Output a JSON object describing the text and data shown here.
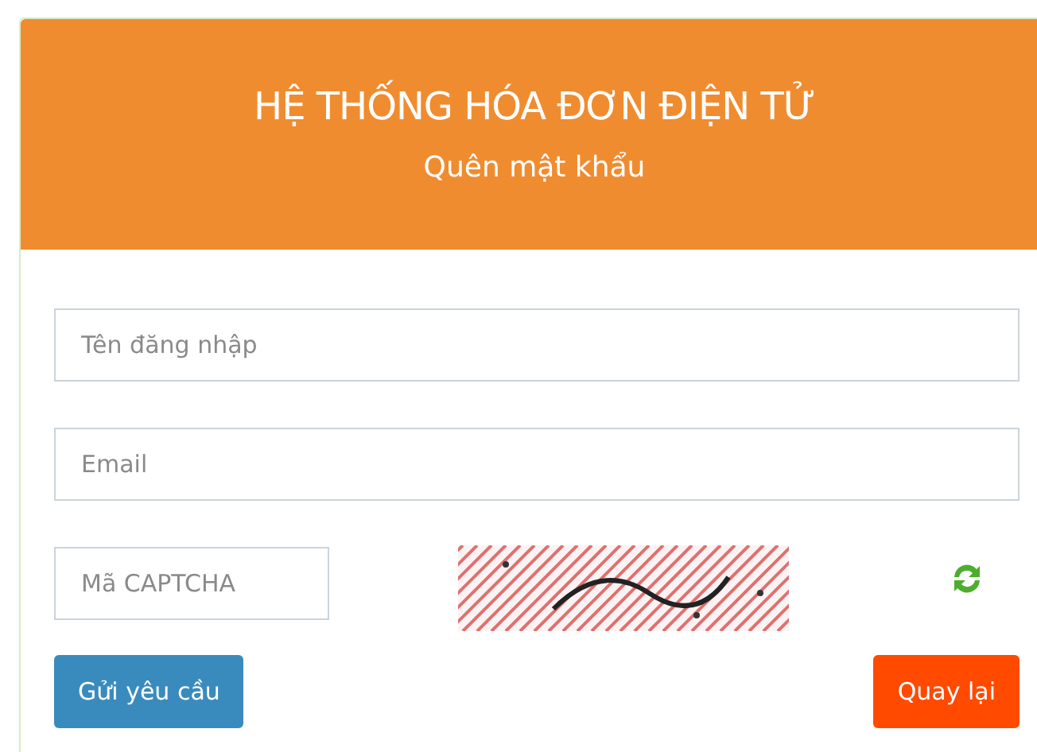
{
  "header": {
    "title": "HỆ THỐNG HÓA ĐƠN ĐIỆN TỬ",
    "subtitle": "Quên mật khẩu"
  },
  "fields": [
    {
      "placeholder": "Tên đăng nhập"
    },
    {
      "placeholder": "Email"
    }
  ],
  "captcha": {
    "placeholder": "Mã CAPTCHA"
  },
  "buttons": {
    "submit": "Gửi yêu cầu",
    "back": "Quay lại"
  }
}
